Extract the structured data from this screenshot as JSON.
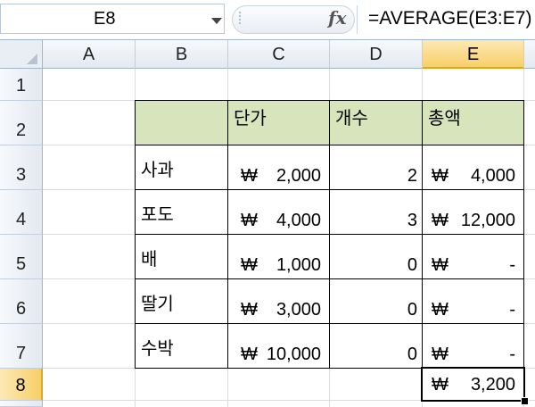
{
  "name_box": {
    "value": "E8"
  },
  "formula_bar": {
    "fx_label": "fx",
    "formula": "=AVERAGE(E3:E7)"
  },
  "columns": [
    "A",
    "B",
    "C",
    "D",
    "E"
  ],
  "rows": [
    "1",
    "2",
    "3",
    "4",
    "5",
    "6",
    "7",
    "8"
  ],
  "selected_cell": "E8",
  "header_fill_color": "#d8e4bc",
  "selection_color": "#f8cf68",
  "currency": "₩",
  "table": {
    "headers": [
      "",
      "단가",
      "개수",
      "총액"
    ],
    "rows": [
      {
        "item": "사과",
        "price": "2,000",
        "count": "2",
        "total": "4,000"
      },
      {
        "item": "포도",
        "price": "4,000",
        "count": "3",
        "total": "12,000"
      },
      {
        "item": "배",
        "price": "1,000",
        "count": "0",
        "total": "-"
      },
      {
        "item": "딸기",
        "price": "3,000",
        "count": "0",
        "total": "-"
      },
      {
        "item": "수박",
        "price": "10,000",
        "count": "0",
        "total": "-"
      }
    ]
  },
  "average": {
    "value": "3,200"
  }
}
